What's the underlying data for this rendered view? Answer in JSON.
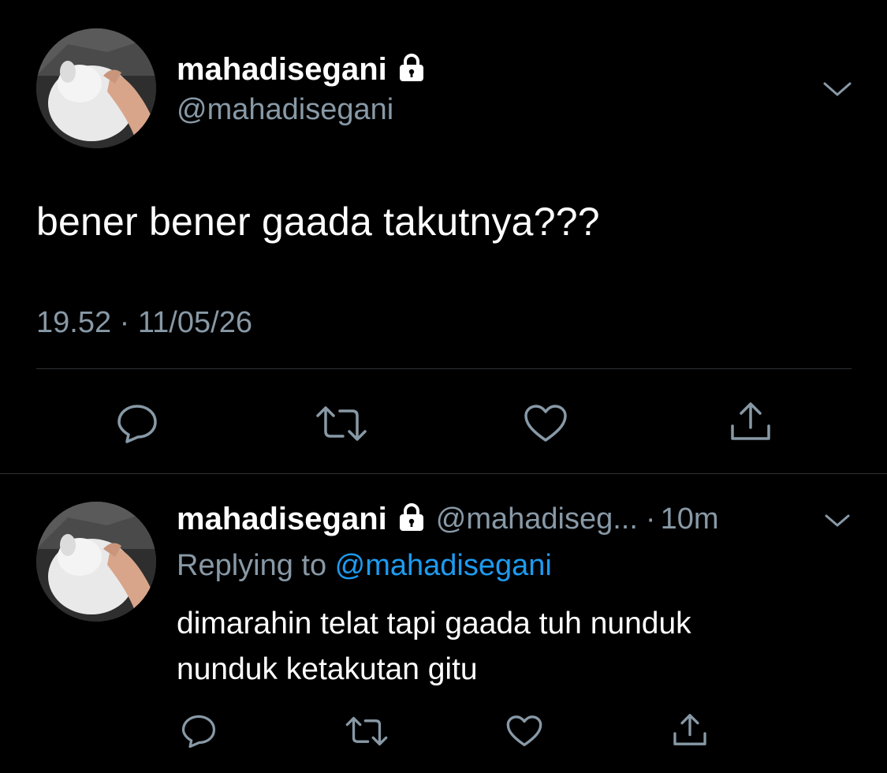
{
  "tweet": {
    "display_name": "mahadisegani",
    "handle": "@mahadisegani",
    "text": "bener bener gaada takutnya???",
    "timestamp": "19.52 · 11/05/26",
    "actions": [
      "reply-icon",
      "retweet-icon",
      "like-icon",
      "share-icon"
    ]
  },
  "reply": {
    "display_name": "mahadisegani",
    "handle": "@mahadiseg...",
    "separator": "·",
    "time": "10m",
    "replying_prefix": "Replying to ",
    "replying_to": "@mahadisegani",
    "text_line1": "dimarahin telat tapi gaada tuh nunduk",
    "text_line2": "nunduk ketakutan gitu"
  },
  "colors": {
    "background": "#000000",
    "text": "#ffffff",
    "secondary": "#8899a6",
    "link": "#1d9bf0",
    "divider": "#2f3336"
  }
}
